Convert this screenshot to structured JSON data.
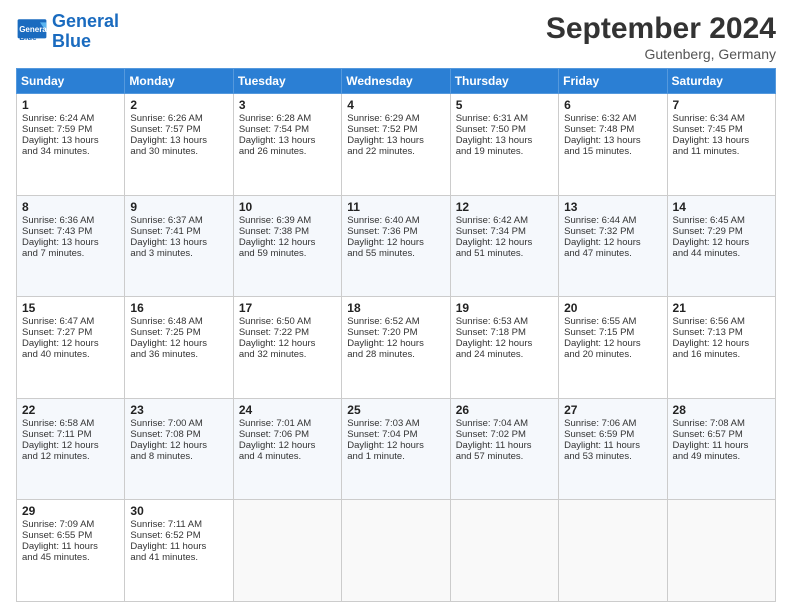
{
  "logo": {
    "line1": "General",
    "line2": "Blue"
  },
  "title": "September 2024",
  "subtitle": "Gutenberg, Germany",
  "header_days": [
    "Sunday",
    "Monday",
    "Tuesday",
    "Wednesday",
    "Thursday",
    "Friday",
    "Saturday"
  ],
  "weeks": [
    [
      {
        "day": "1",
        "lines": [
          "Sunrise: 6:24 AM",
          "Sunset: 7:59 PM",
          "Daylight: 13 hours",
          "and 34 minutes."
        ]
      },
      {
        "day": "2",
        "lines": [
          "Sunrise: 6:26 AM",
          "Sunset: 7:57 PM",
          "Daylight: 13 hours",
          "and 30 minutes."
        ]
      },
      {
        "day": "3",
        "lines": [
          "Sunrise: 6:28 AM",
          "Sunset: 7:54 PM",
          "Daylight: 13 hours",
          "and 26 minutes."
        ]
      },
      {
        "day": "4",
        "lines": [
          "Sunrise: 6:29 AM",
          "Sunset: 7:52 PM",
          "Daylight: 13 hours",
          "and 22 minutes."
        ]
      },
      {
        "day": "5",
        "lines": [
          "Sunrise: 6:31 AM",
          "Sunset: 7:50 PM",
          "Daylight: 13 hours",
          "and 19 minutes."
        ]
      },
      {
        "day": "6",
        "lines": [
          "Sunrise: 6:32 AM",
          "Sunset: 7:48 PM",
          "Daylight: 13 hours",
          "and 15 minutes."
        ]
      },
      {
        "day": "7",
        "lines": [
          "Sunrise: 6:34 AM",
          "Sunset: 7:45 PM",
          "Daylight: 13 hours",
          "and 11 minutes."
        ]
      }
    ],
    [
      {
        "day": "8",
        "lines": [
          "Sunrise: 6:36 AM",
          "Sunset: 7:43 PM",
          "Daylight: 13 hours",
          "and 7 minutes."
        ]
      },
      {
        "day": "9",
        "lines": [
          "Sunrise: 6:37 AM",
          "Sunset: 7:41 PM",
          "Daylight: 13 hours",
          "and 3 minutes."
        ]
      },
      {
        "day": "10",
        "lines": [
          "Sunrise: 6:39 AM",
          "Sunset: 7:38 PM",
          "Daylight: 12 hours",
          "and 59 minutes."
        ]
      },
      {
        "day": "11",
        "lines": [
          "Sunrise: 6:40 AM",
          "Sunset: 7:36 PM",
          "Daylight: 12 hours",
          "and 55 minutes."
        ]
      },
      {
        "day": "12",
        "lines": [
          "Sunrise: 6:42 AM",
          "Sunset: 7:34 PM",
          "Daylight: 12 hours",
          "and 51 minutes."
        ]
      },
      {
        "day": "13",
        "lines": [
          "Sunrise: 6:44 AM",
          "Sunset: 7:32 PM",
          "Daylight: 12 hours",
          "and 47 minutes."
        ]
      },
      {
        "day": "14",
        "lines": [
          "Sunrise: 6:45 AM",
          "Sunset: 7:29 PM",
          "Daylight: 12 hours",
          "and 44 minutes."
        ]
      }
    ],
    [
      {
        "day": "15",
        "lines": [
          "Sunrise: 6:47 AM",
          "Sunset: 7:27 PM",
          "Daylight: 12 hours",
          "and 40 minutes."
        ]
      },
      {
        "day": "16",
        "lines": [
          "Sunrise: 6:48 AM",
          "Sunset: 7:25 PM",
          "Daylight: 12 hours",
          "and 36 minutes."
        ]
      },
      {
        "day": "17",
        "lines": [
          "Sunrise: 6:50 AM",
          "Sunset: 7:22 PM",
          "Daylight: 12 hours",
          "and 32 minutes."
        ]
      },
      {
        "day": "18",
        "lines": [
          "Sunrise: 6:52 AM",
          "Sunset: 7:20 PM",
          "Daylight: 12 hours",
          "and 28 minutes."
        ]
      },
      {
        "day": "19",
        "lines": [
          "Sunrise: 6:53 AM",
          "Sunset: 7:18 PM",
          "Daylight: 12 hours",
          "and 24 minutes."
        ]
      },
      {
        "day": "20",
        "lines": [
          "Sunrise: 6:55 AM",
          "Sunset: 7:15 PM",
          "Daylight: 12 hours",
          "and 20 minutes."
        ]
      },
      {
        "day": "21",
        "lines": [
          "Sunrise: 6:56 AM",
          "Sunset: 7:13 PM",
          "Daylight: 12 hours",
          "and 16 minutes."
        ]
      }
    ],
    [
      {
        "day": "22",
        "lines": [
          "Sunrise: 6:58 AM",
          "Sunset: 7:11 PM",
          "Daylight: 12 hours",
          "and 12 minutes."
        ]
      },
      {
        "day": "23",
        "lines": [
          "Sunrise: 7:00 AM",
          "Sunset: 7:08 PM",
          "Daylight: 12 hours",
          "and 8 minutes."
        ]
      },
      {
        "day": "24",
        "lines": [
          "Sunrise: 7:01 AM",
          "Sunset: 7:06 PM",
          "Daylight: 12 hours",
          "and 4 minutes."
        ]
      },
      {
        "day": "25",
        "lines": [
          "Sunrise: 7:03 AM",
          "Sunset: 7:04 PM",
          "Daylight: 12 hours",
          "and 1 minute."
        ]
      },
      {
        "day": "26",
        "lines": [
          "Sunrise: 7:04 AM",
          "Sunset: 7:02 PM",
          "Daylight: 11 hours",
          "and 57 minutes."
        ]
      },
      {
        "day": "27",
        "lines": [
          "Sunrise: 7:06 AM",
          "Sunset: 6:59 PM",
          "Daylight: 11 hours",
          "and 53 minutes."
        ]
      },
      {
        "day": "28",
        "lines": [
          "Sunrise: 7:08 AM",
          "Sunset: 6:57 PM",
          "Daylight: 11 hours",
          "and 49 minutes."
        ]
      }
    ],
    [
      {
        "day": "29",
        "lines": [
          "Sunrise: 7:09 AM",
          "Sunset: 6:55 PM",
          "Daylight: 11 hours",
          "and 45 minutes."
        ]
      },
      {
        "day": "30",
        "lines": [
          "Sunrise: 7:11 AM",
          "Sunset: 6:52 PM",
          "Daylight: 11 hours",
          "and 41 minutes."
        ]
      },
      {
        "day": "",
        "lines": []
      },
      {
        "day": "",
        "lines": []
      },
      {
        "day": "",
        "lines": []
      },
      {
        "day": "",
        "lines": []
      },
      {
        "day": "",
        "lines": []
      }
    ]
  ]
}
